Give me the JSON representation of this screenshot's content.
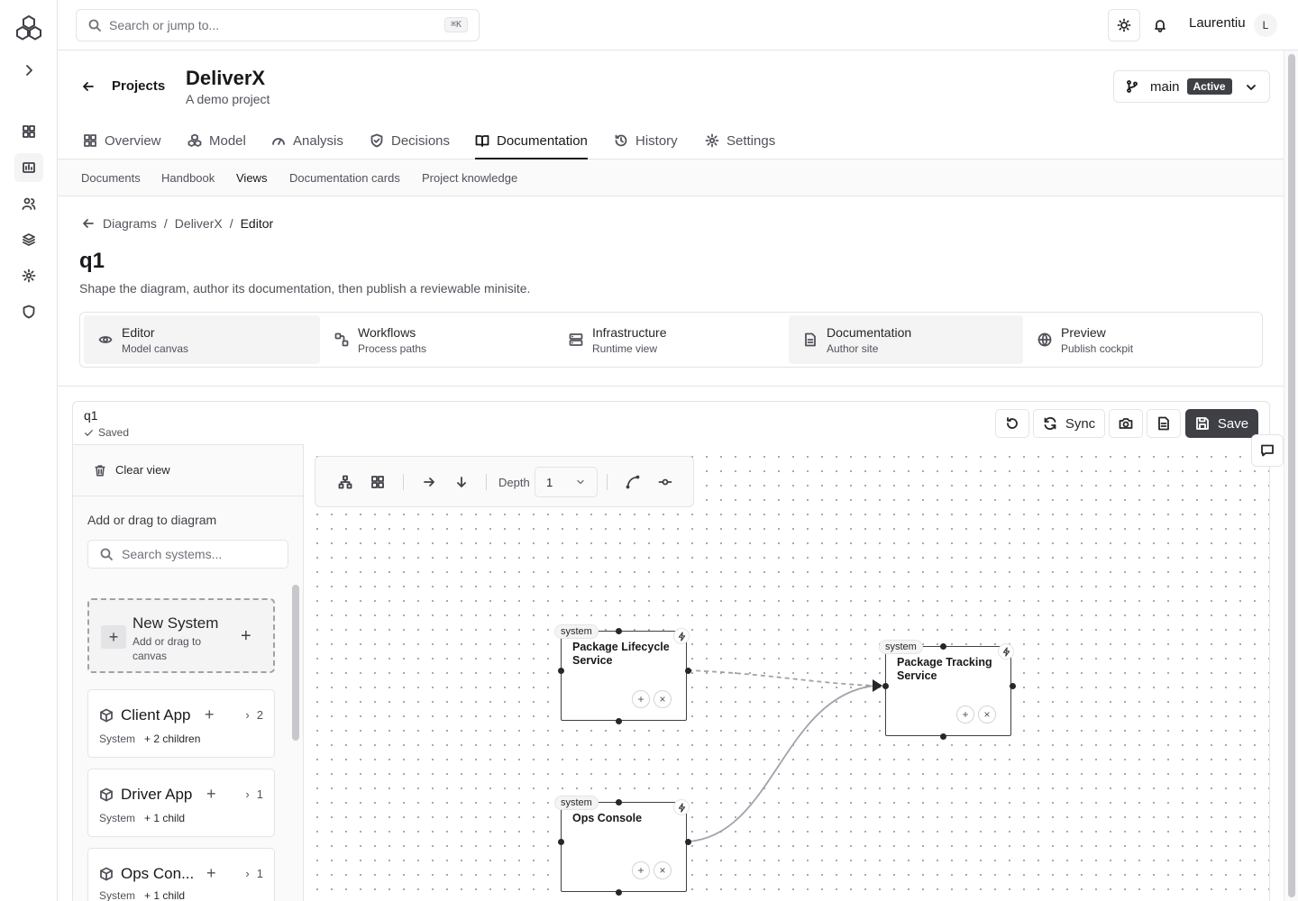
{
  "topbar": {
    "search_placeholder": "Search or jump to...",
    "search_shortcut": "⌘K",
    "user_name": "Laurentiu",
    "avatar_initial": "L"
  },
  "project": {
    "back_label": "Projects",
    "title": "DeliverX",
    "subtitle": "A demo project",
    "branch_name": "main",
    "branch_status": "Active"
  },
  "tabs": [
    {
      "label": "Overview",
      "icon": "grid-icon"
    },
    {
      "label": "Model",
      "icon": "cubes-icon"
    },
    {
      "label": "Analysis",
      "icon": "gauge-icon"
    },
    {
      "label": "Decisions",
      "icon": "shield-check-icon"
    },
    {
      "label": "Documentation",
      "icon": "book-icon",
      "active": true
    },
    {
      "label": "History",
      "icon": "history-icon"
    },
    {
      "label": "Settings",
      "icon": "gear-icon"
    }
  ],
  "subtabs": [
    {
      "label": "Documents"
    },
    {
      "label": "Handbook"
    },
    {
      "label": "Views",
      "active": true
    },
    {
      "label": "Documentation cards"
    },
    {
      "label": "Project knowledge"
    }
  ],
  "breadcrumb": {
    "items": [
      "Diagrams",
      "DeliverX"
    ],
    "current": "Editor",
    "separator": "/"
  },
  "page": {
    "title": "q1",
    "subtitle": "Shape the diagram, author its documentation, then publish a reviewable minisite."
  },
  "modes": [
    {
      "title": "Editor",
      "sub": "Model canvas",
      "icon": "eye-icon",
      "selected": true
    },
    {
      "title": "Workflows",
      "sub": "Process paths",
      "icon": "workflow-icon"
    },
    {
      "title": "Infrastructure",
      "sub": "Runtime view",
      "icon": "server-icon"
    },
    {
      "title": "Documentation",
      "sub": "Author site",
      "icon": "file-icon",
      "selected": true
    },
    {
      "title": "Preview",
      "sub": "Publish cockpit",
      "icon": "globe-icon"
    }
  ],
  "editor": {
    "name": "q1",
    "status": "Saved",
    "sync_label": "Sync",
    "save_label": "Save"
  },
  "panel": {
    "clear_view": "Clear view",
    "heading": "Add or drag to diagram",
    "search_placeholder": "Search systems...",
    "new_system": {
      "title": "New System",
      "subtitle": "Add or drag to canvas"
    },
    "systems": [
      {
        "name": "Client App",
        "kind": "System",
        "children": "+ 2 children",
        "count": "2"
      },
      {
        "name": "Driver App",
        "kind": "System",
        "children": "+ 1 child",
        "count": "1"
      },
      {
        "name": "Ops Con...",
        "kind": "System",
        "children": "+ 1 child",
        "count": "1"
      }
    ]
  },
  "toolbar": {
    "depth_label": "Depth",
    "depth_value": "1"
  },
  "nodes": [
    {
      "tag": "system",
      "name": "Package Lifecycle Service"
    },
    {
      "tag": "system",
      "name": "Package Tracking Service"
    },
    {
      "tag": "system",
      "name": "Ops Console"
    }
  ],
  "node_controls": {
    "add": "+",
    "remove": "×"
  },
  "colors": {
    "accent": "#3f3f46",
    "border": "#e4e4e7",
    "muted": "#52525b"
  }
}
